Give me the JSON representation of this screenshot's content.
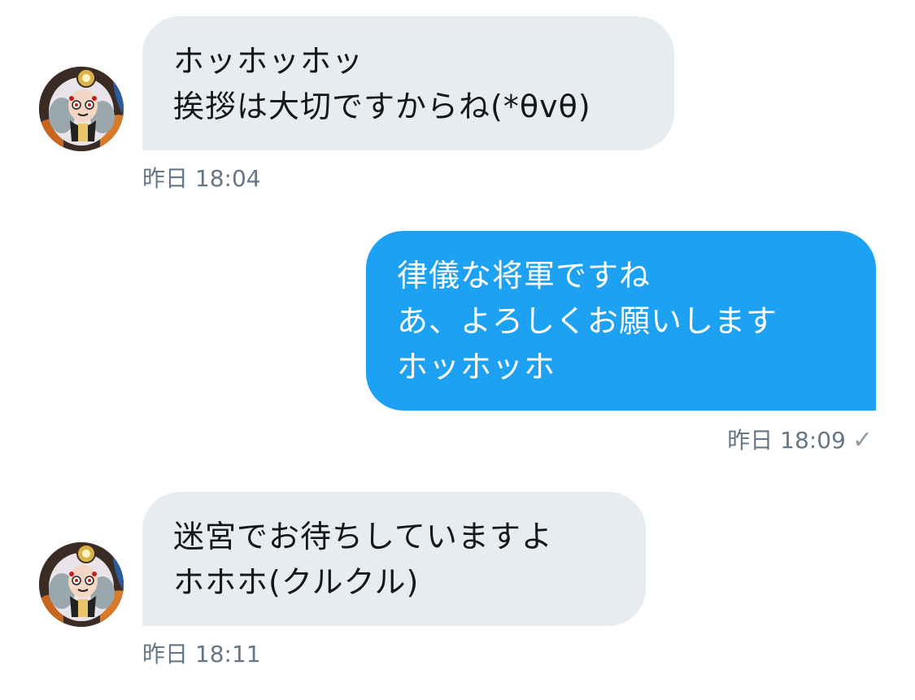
{
  "messages": [
    {
      "direction": "incoming",
      "text": "ホッホッホッ\n挨拶は大切ですからね(*θvθ)",
      "timestamp": "昨日 18:04",
      "avatar_icon": "contact-avatar"
    },
    {
      "direction": "outgoing",
      "text": "律儀な将軍ですね\nあ、よろしくお願いします\nホッホッホ",
      "timestamp": "昨日 18:09",
      "read_icon": "✓"
    },
    {
      "direction": "incoming",
      "text": "迷宮でお待ちしていますよ\nホホホ(クルクル)",
      "timestamp": "昨日 18:11",
      "avatar_icon": "contact-avatar"
    }
  ],
  "colors": {
    "incoming_bubble": "#e6ecf0",
    "outgoing_bubble": "#1da1f2",
    "timestamp": "#657786",
    "incoming_text": "#14171a",
    "outgoing_text": "#ffffff"
  }
}
